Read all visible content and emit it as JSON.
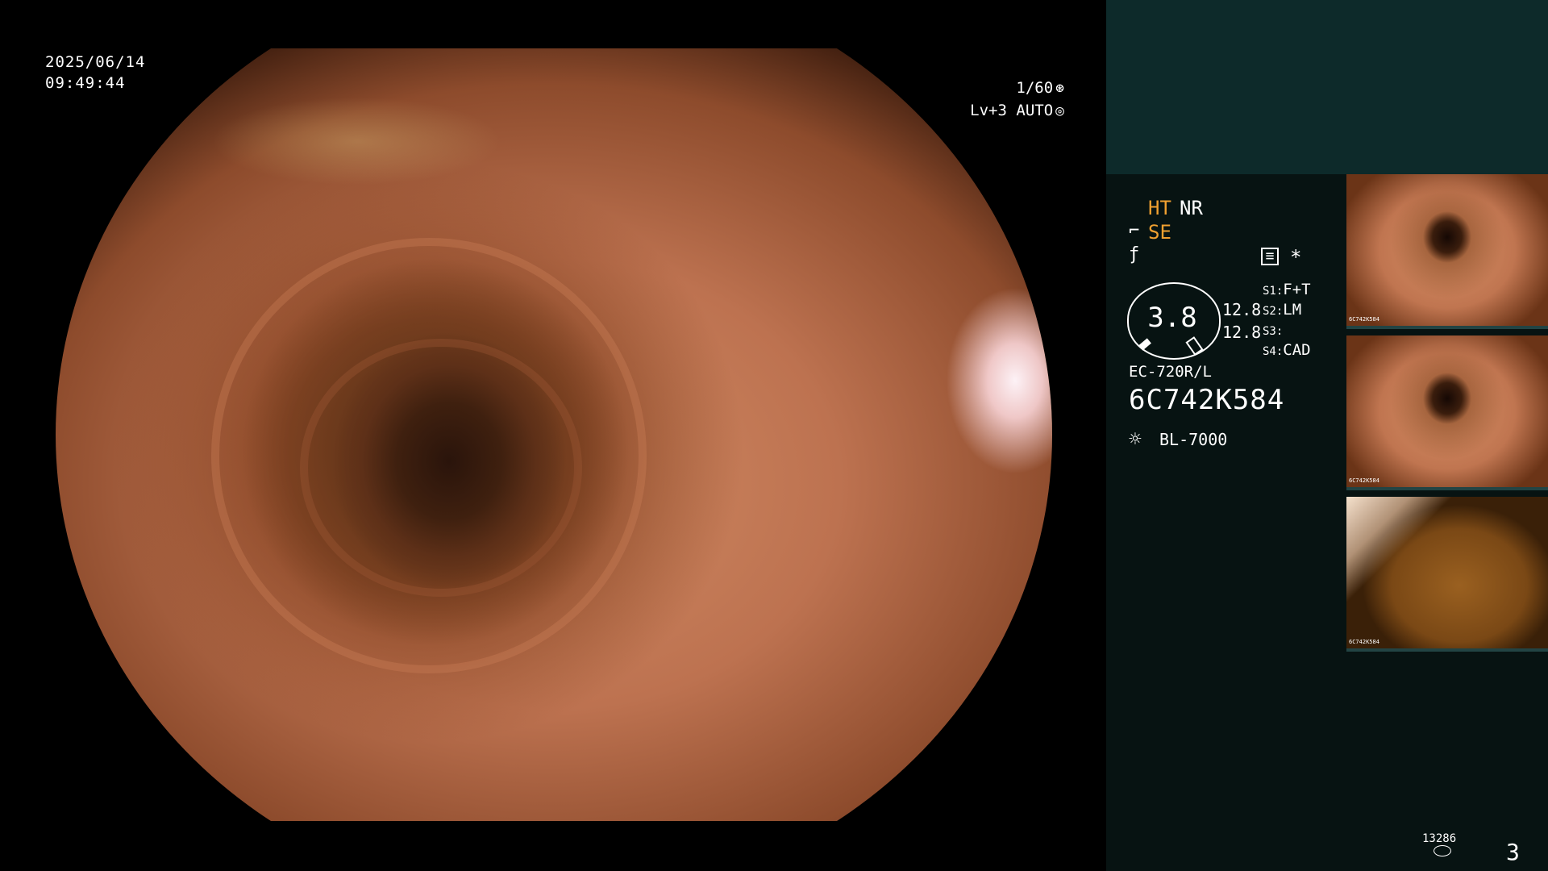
{
  "overlay": {
    "date": "2025/06/14",
    "time": "09:49:44",
    "shutter": "1/60",
    "shutter_icon": "aperture-icon",
    "level": "Lv+3",
    "exposure_mode": "AUTO",
    "exposure_icon": "iris-icon"
  },
  "panel": {
    "ht": "HT",
    "nr": "NR",
    "se": "SE",
    "enhancement_icon": "filter-icon",
    "record_icon": "record-icon",
    "asterisk": "*",
    "dial_value": "3.8",
    "value_1": "12.8",
    "value_2": "12.8",
    "slots": [
      {
        "key": "S1:",
        "value": "F+T"
      },
      {
        "key": "S2:",
        "value": "LM"
      },
      {
        "key": "S3:",
        "value": ""
      },
      {
        "key": "S4:",
        "value": "CAD"
      }
    ],
    "scope_model": "EC-720R/L",
    "serial": "6C742K584",
    "light_source": "BL-7000",
    "thumb_label": "6C742K584",
    "counter": "13286",
    "page_number": "3"
  },
  "colors": {
    "accent_orange": "#f0a030",
    "panel_bg": "#071312",
    "panel_top": "#0d2a2a"
  }
}
